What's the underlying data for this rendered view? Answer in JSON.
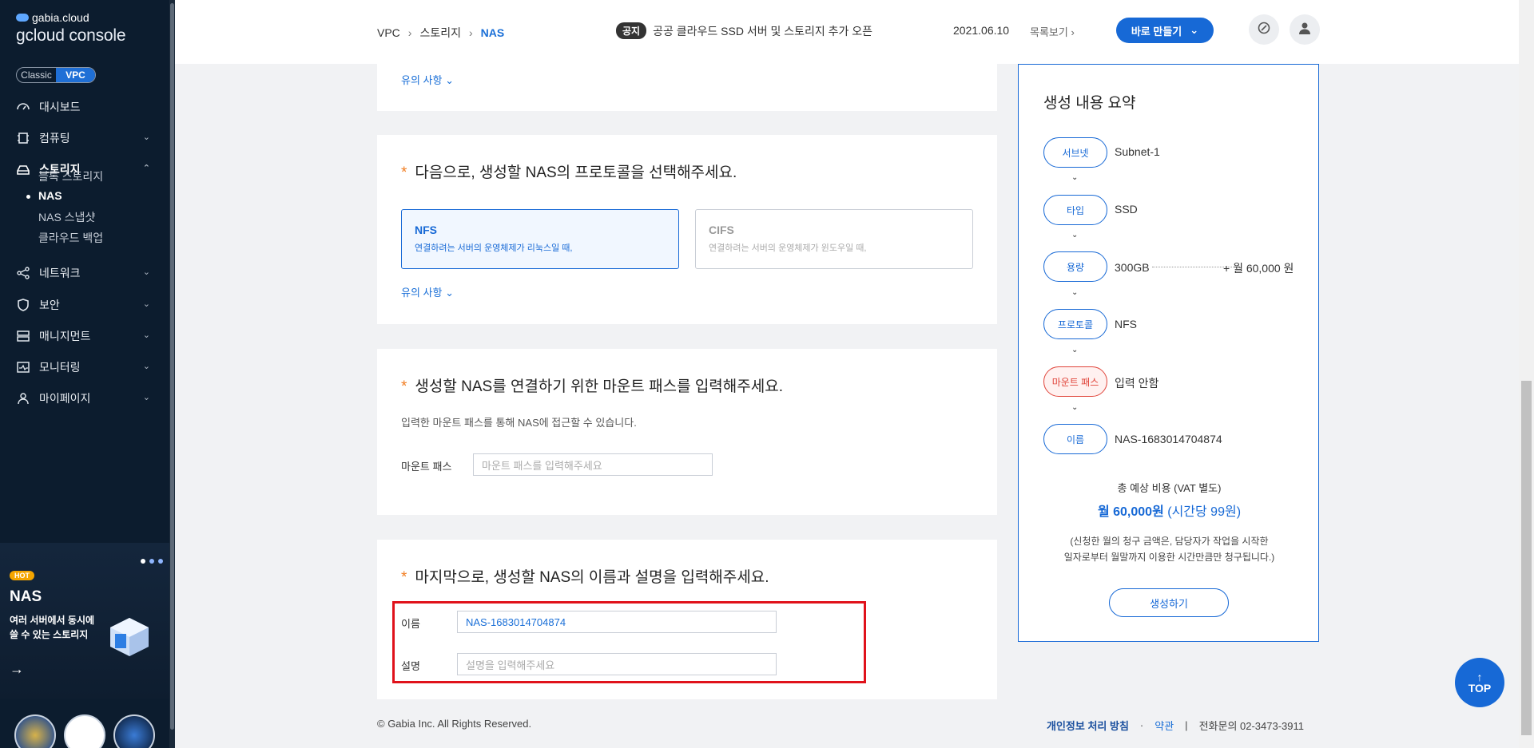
{
  "sidebar": {
    "brand": "gabia.cloud",
    "console": "gcloud console",
    "toggle": [
      "Classic",
      "VPC"
    ],
    "menu": [
      {
        "label": "대시보드",
        "icon": "dashboard-icon"
      },
      {
        "label": "컴퓨팅",
        "icon": "cpu-icon"
      },
      {
        "label": "스토리지",
        "icon": "storage-icon"
      },
      {
        "label": "네트워크",
        "icon": "network-icon"
      },
      {
        "label": "보안",
        "icon": "shield-icon"
      },
      {
        "label": "매니지먼트",
        "icon": "management-icon"
      },
      {
        "label": "모니터링",
        "icon": "monitoring-icon"
      },
      {
        "label": "마이페이지",
        "icon": "user-icon"
      }
    ],
    "storage_sub": [
      "블록 스토리지",
      "NAS",
      "NAS 스냅샷",
      "클라우드 백업"
    ],
    "promo": {
      "hot": "HOT",
      "title": "NAS",
      "desc": "여러 서버에서 동시에 쓸 수 있는 스토리지"
    }
  },
  "header": {
    "breadcrumb": [
      "VPC",
      "스토리지",
      "NAS"
    ],
    "notice_tag": "공지",
    "notice_text": "공공 클라우드 SSD 서버 및 스토리지 추가 오픈",
    "notice_date": "2021.06.10",
    "notice_list": "목록보기",
    "make_button": "바로 만들기"
  },
  "main": {
    "note_link": "유의 사항",
    "protocol": {
      "title": "다음으로, 생성할 NAS의 프로토콜을 선택해주세요.",
      "options": [
        {
          "title": "NFS",
          "desc": "연결하려는 서버의 운영체제가 리눅스일 때,"
        },
        {
          "title": "CIFS",
          "desc": "연결하려는 서버의 운영체제가 윈도우일 때,"
        }
      ]
    },
    "mount": {
      "title": "생성할 NAS를 연결하기 위한 마운트 패스를 입력해주세요.",
      "desc": "입력한 마운트 패스를 통해 NAS에 접근할 수 있습니다.",
      "label": "마운트 패스",
      "placeholder": "마운트 패스를 입력해주세요"
    },
    "name": {
      "title": "마지막으로, 생성할 NAS의 이름과 설명을 입력해주세요.",
      "name_label": "이름",
      "name_value": "NAS-1683014704874",
      "desc_label": "설명",
      "desc_placeholder": "설명을 입력해주세요"
    }
  },
  "summary": {
    "title": "생성 내용 요약",
    "steps": [
      {
        "label": "서브넷",
        "value": "Subnet-1"
      },
      {
        "label": "타입",
        "value": "SSD"
      },
      {
        "label": "용량",
        "value": "300GB"
      },
      {
        "label": "프로토콜",
        "value": "NFS"
      },
      {
        "label": "마운트 패스",
        "value": "입력 안함"
      },
      {
        "label": "이름",
        "value": "NAS-1683014704874"
      }
    ],
    "price": "+ 월 60,000 원",
    "total_label": "총 예상 비용 (VAT 별도)",
    "total_main": "월 60,000원",
    "total_sub": "(시간당 99원)",
    "note_line1": "(신청한 월의 청구 금액은, 담당자가 작업을 시작한",
    "note_line2": "일자로부터 월말까지 이용한 시간만큼만 청구됩니다.)",
    "create_button": "생성하기"
  },
  "footer": {
    "copyright": "© Gabia Inc. All Rights Reserved.",
    "privacy": "개인정보 처리 방침",
    "dot": "·",
    "terms": "약관",
    "bar": "|",
    "contact": "전화문의  02-3473-3911"
  },
  "top_button": "TOP",
  "colors": {
    "accent": "#1769d6",
    "sidebar": "#0c1c2e",
    "required": "#f17d21",
    "error": "#e0443a"
  }
}
